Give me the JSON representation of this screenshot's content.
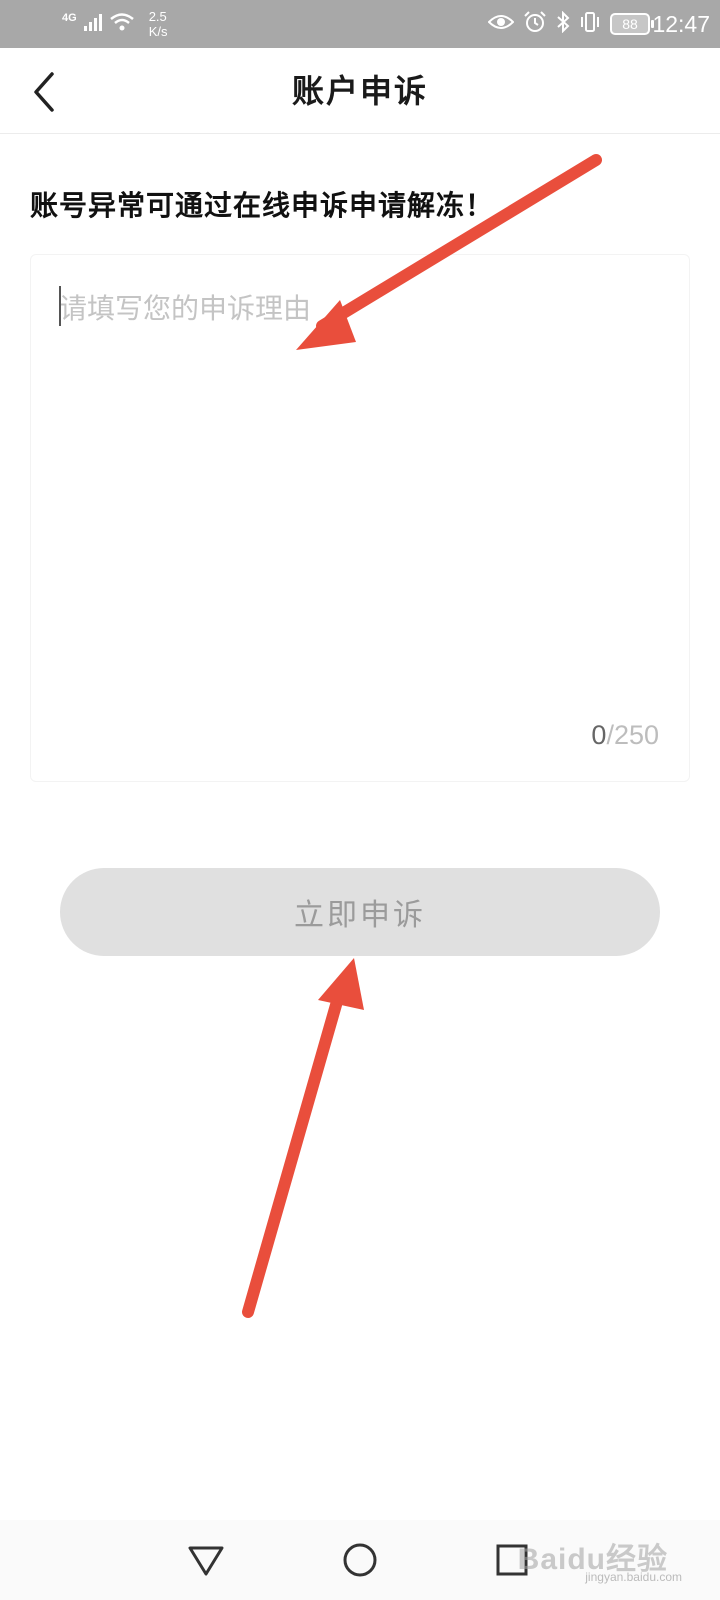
{
  "status_bar": {
    "network": "4G",
    "speed_value": "2.5",
    "speed_unit": "K/s",
    "battery": "88",
    "time": "12:47"
  },
  "header": {
    "title": "账户申诉"
  },
  "main": {
    "notice": "账号异常可通过在线申诉申请解冻！",
    "reason_placeholder": "请填写您的申诉理由",
    "char_count": "0",
    "char_limit": "/250",
    "submit_label": "立即申诉"
  },
  "watermark": {
    "brand": "Baidu经验",
    "url": "jingyan.baidu.com"
  },
  "colors": {
    "status_bar_bg": "#a8a8a8",
    "button_bg": "#e0e0e0",
    "button_text": "#9b9b9b",
    "annotation_arrow": "#e94e3c"
  }
}
